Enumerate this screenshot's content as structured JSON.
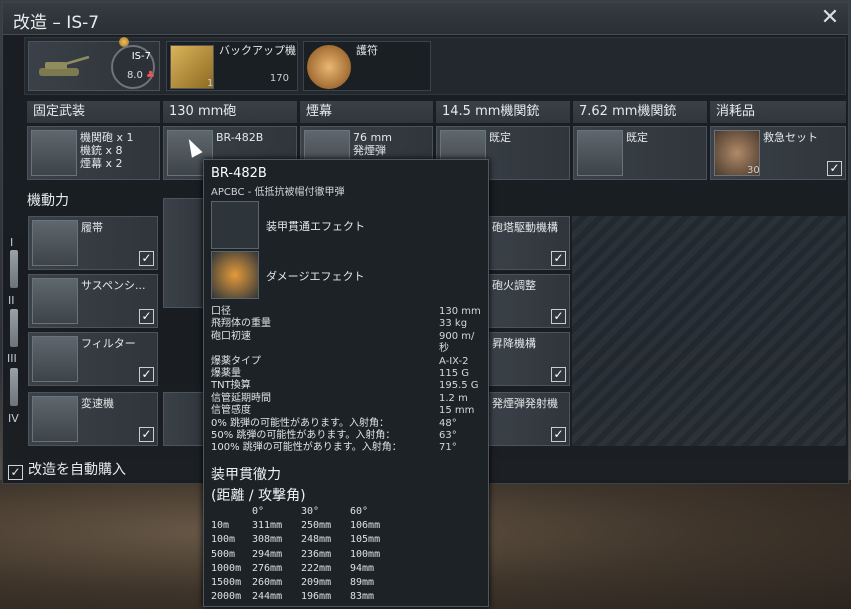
{
  "window": {
    "title": "改造 – IS-7",
    "close_label": "✕"
  },
  "vehicle": {
    "name": "IS-7",
    "br": "8.0",
    "icon": "tank-icon"
  },
  "backup": {
    "label": "バックアップ機",
    "count": "1",
    "price": "170"
  },
  "talisman": {
    "label": "護符"
  },
  "columns": [
    {
      "header": "固定武装",
      "cell_text": "機関砲 x 1\n機銃 x 8\n煙幕 x 2",
      "checked": false
    },
    {
      "header": "130 mm砲",
      "cell_text": "BR-482B",
      "checked": false
    },
    {
      "header": "煙幕",
      "cell_text": "76 mm\n発煙弾",
      "checked": false
    },
    {
      "header": "14.5 mm機関銃",
      "cell_text": "既定",
      "checked": false
    },
    {
      "header": "7.62 mm機関銃",
      "cell_text": "既定",
      "checked": false
    },
    {
      "header": "消耗品",
      "cell_text": "救急セット",
      "count": "30",
      "checked": true
    }
  ],
  "mobility": {
    "header": "機動力",
    "items": [
      "履帯",
      "サスペンシ...",
      "フィルター",
      "変速機"
    ]
  },
  "firepower_right": {
    "items": [
      "砲塔駆動機構",
      "砲火調整",
      "昇降機構",
      "発煙弾発射機"
    ]
  },
  "tiers": [
    "I",
    "II",
    "III",
    "IV"
  ],
  "autobuy": {
    "label": "改造を自動購入",
    "checked": true
  },
  "tooltip": {
    "name": "BR-482B",
    "type": "APCBC - 低抵抗被帽付徹甲弾",
    "effects": [
      "装甲貫通エフェクト",
      "ダメージエフェクト"
    ],
    "stats": [
      [
        "口径",
        "130 mm"
      ],
      [
        "飛翔体の重量",
        "33 kg"
      ],
      [
        "砲口初速",
        "900 m/秒"
      ],
      [
        "爆薬タイプ",
        "A-IX-2"
      ],
      [
        "爆薬量",
        "115 G"
      ],
      [
        "TNT換算",
        "195.5 G"
      ],
      [
        "信管延期時間",
        "1.2 m"
      ],
      [
        "信管感度",
        "15 mm"
      ],
      [
        "0% 跳弾の可能性があります。入射角：",
        "48°"
      ],
      [
        "50% 跳弾の可能性があります。入射角：",
        "63°"
      ],
      [
        "100% 跳弾の可能性があります。入射角：",
        "71°"
      ]
    ],
    "pen_title": "装甲貫徹力",
    "pen_subtitle": "(距離 / 攻撃角)",
    "pen_angles": [
      "0°",
      "30°",
      "60°"
    ],
    "pen_rows": [
      [
        "10m",
        "311mm",
        "250mm",
        "106mm"
      ],
      [
        "100m",
        "308mm",
        "248mm",
        "105mm"
      ],
      [
        "500m",
        "294mm",
        "236mm",
        "100mm"
      ],
      [
        "1000m",
        "276mm",
        "222mm",
        "94mm"
      ],
      [
        "1500m",
        "260mm",
        "209mm",
        "89mm"
      ],
      [
        "2000m",
        "244mm",
        "196mm",
        "83mm"
      ]
    ]
  }
}
